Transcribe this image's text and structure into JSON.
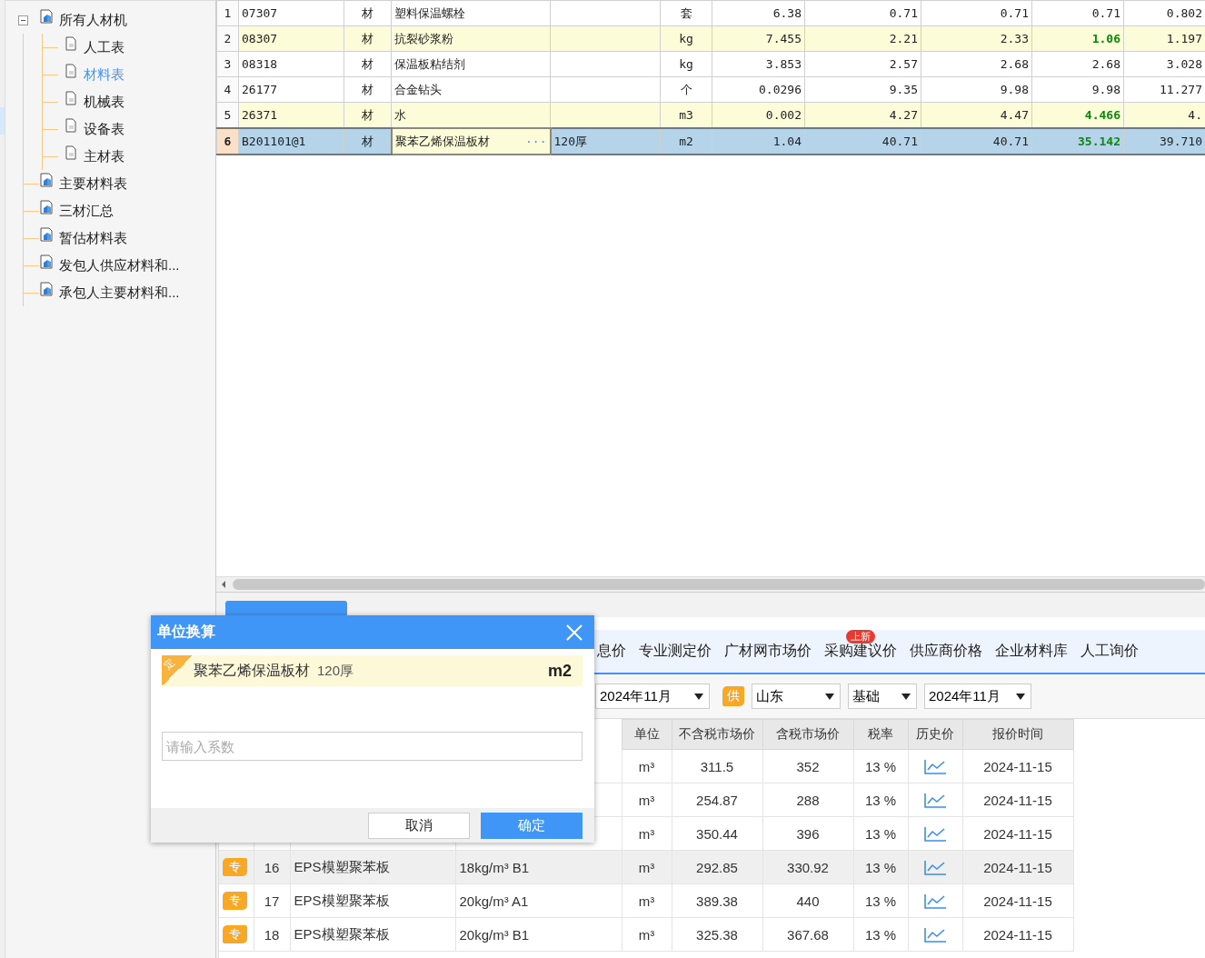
{
  "tree": [
    {
      "label": "所有人材机",
      "kind": "report",
      "expanded": true,
      "selected": false,
      "children": [
        {
          "label": "人工表",
          "kind": "page",
          "selected": false
        },
        {
          "label": "材料表",
          "kind": "page",
          "selected": true
        },
        {
          "label": "机械表",
          "kind": "page",
          "selected": false
        },
        {
          "label": "设备表",
          "kind": "page",
          "selected": false
        },
        {
          "label": "主材表",
          "kind": "page",
          "selected": false
        }
      ]
    },
    {
      "label": "主要材料表",
      "kind": "report",
      "selected": false
    },
    {
      "label": "三材汇总",
      "kind": "report",
      "selected": false
    },
    {
      "label": "暂估材料表",
      "kind": "report",
      "selected": false
    },
    {
      "label": "发包人供应材料和...",
      "kind": "report",
      "selected": false
    },
    {
      "label": "承包人主要材料和...",
      "kind": "report",
      "selected": false
    }
  ],
  "grid": {
    "rows": [
      {
        "no": "1",
        "code": "07307",
        "type": "材",
        "name": "塑料保温螺栓",
        "unit": "套",
        "values": [
          "6.38",
          "0.71",
          "0.71",
          "0.71",
          "0.802"
        ],
        "highlighted": false,
        "flagged": false,
        "selected": false
      },
      {
        "no": "2",
        "code": "08307",
        "type": "材",
        "name": "抗裂砂浆粉",
        "unit": "kg",
        "values": [
          "7.455",
          "2.21",
          "2.33",
          "1.06",
          "1.197"
        ],
        "highlighted": true,
        "flagged": true,
        "selected": false
      },
      {
        "no": "3",
        "code": "08318",
        "type": "材",
        "name": "保温板粘结剂",
        "unit": "kg",
        "values": [
          "3.853",
          "2.57",
          "2.68",
          "2.68",
          "3.028"
        ],
        "highlighted": false,
        "flagged": false,
        "selected": false
      },
      {
        "no": "4",
        "code": "26177",
        "type": "材",
        "name": "合金钻头",
        "unit": "个",
        "values": [
          "0.0296",
          "9.35",
          "9.98",
          "9.98",
          "11.277"
        ],
        "highlighted": false,
        "flagged": false,
        "selected": false
      },
      {
        "no": "5",
        "code": "26371",
        "type": "材",
        "name": "水",
        "unit": "m3",
        "values": [
          "0.002",
          "4.27",
          "4.47",
          "4.466",
          "4."
        ],
        "highlighted": true,
        "flagged": true,
        "selected": false
      },
      {
        "no": "6",
        "code": "B201101@1",
        "type": "材",
        "name": "聚苯乙烯保温板材",
        "name_button": "···",
        "spec": "120厚",
        "unit": "m2",
        "values": [
          "1.04",
          "40.71",
          "40.71",
          "35.142",
          "39.710"
        ],
        "highlighted": false,
        "flagged": true,
        "selected": true
      }
    ]
  },
  "price_tabs": [
    {
      "label": "息价",
      "selected": false
    },
    {
      "label": "专业测定价",
      "selected": false
    },
    {
      "label": "广材网市场价",
      "selected": false
    },
    {
      "label": "采购建议价",
      "selected": false,
      "badge": "上新"
    },
    {
      "label": "供应商价格",
      "selected": false
    },
    {
      "label": "企业材料库",
      "selected": false
    },
    {
      "label": "人工询价",
      "selected": false
    }
  ],
  "filters": {
    "period": "2024年11月",
    "supplier_tag": "供",
    "region": "山东",
    "level": "基础",
    "supplier_period": "2024年11月"
  },
  "price_table": {
    "columns": [
      "单位",
      "不含税市场价",
      "含税市场价",
      "税率",
      "历史价",
      "报价时间"
    ],
    "rows": [
      {
        "unit": "m³",
        "price_ex_tax": "311.5",
        "price_in_tax": "352",
        "tax": "13 %",
        "date": "2024-11-15",
        "selected": false
      },
      {
        "unit": "m³",
        "price_ex_tax": "254.87",
        "price_in_tax": "288",
        "tax": "13 %",
        "date": "2024-11-15",
        "selected": false
      },
      {
        "unit": "m³",
        "price_ex_tax": "350.44",
        "price_in_tax": "396",
        "tax": "13 %",
        "date": "2024-11-15",
        "selected": false
      },
      {
        "tag": "专",
        "no": "16",
        "name": "EPS模塑聚苯板",
        "spec": "18kg/m³ B1",
        "unit": "m³",
        "price_ex_tax": "292.85",
        "price_in_tax": "330.92",
        "tax": "13 %",
        "date": "2024-11-15",
        "selected": true
      },
      {
        "tag": "专",
        "no": "17",
        "name": "EPS模塑聚苯板",
        "spec": "20kg/m³ A1",
        "unit": "m³",
        "price_ex_tax": "389.38",
        "price_in_tax": "440",
        "tax": "13 %",
        "date": "2024-11-15",
        "selected": false
      },
      {
        "tag": "专",
        "no": "18",
        "name": "EPS模塑聚苯板",
        "spec": "20kg/m³ B1",
        "unit": "m³",
        "price_ex_tax": "325.38",
        "price_in_tax": "367.68",
        "tax": "13 %",
        "date": "2024-11-15",
        "selected": false
      }
    ]
  },
  "dialog": {
    "title": "单位换算",
    "corner_tag": "定",
    "item_name": "聚苯乙烯保温板材",
    "item_spec": "120厚",
    "item_unit": "m2",
    "input": {
      "placeholder": "请输入系数"
    },
    "buttons": [
      {
        "label": "取消",
        "kind": "secondary"
      },
      {
        "label": "确定",
        "kind": "primary"
      }
    ]
  }
}
